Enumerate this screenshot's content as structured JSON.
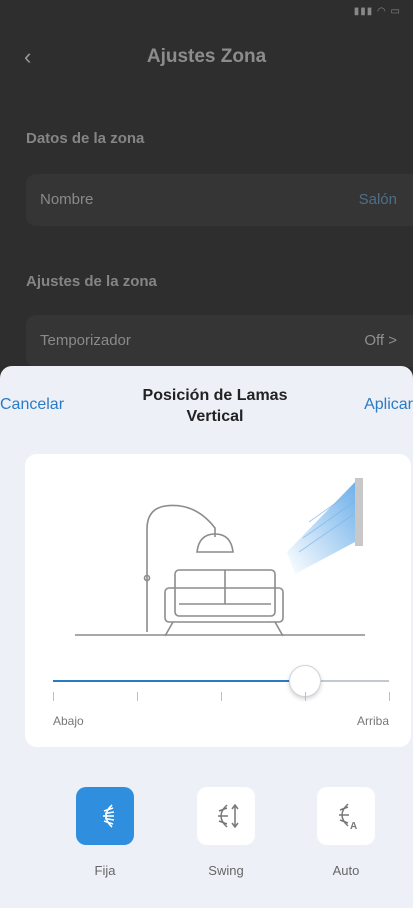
{
  "status_bar": {
    "icons": "signal-wifi-battery"
  },
  "header": {
    "back_icon": "chevron-left-icon",
    "title": "Ajustes Zona"
  },
  "sections": {
    "zone_data": {
      "label": "Datos de la zona",
      "name_row": {
        "label": "Nombre",
        "value": "Salón"
      }
    },
    "zone_settings": {
      "label": "Ajustes de la zona",
      "timer_row": {
        "label": "Temporizador",
        "value": "Off >"
      }
    }
  },
  "sheet": {
    "cancel_label": "Cancelar",
    "title_line1": "Posición de Lamas",
    "title_line2": "Vertical",
    "apply_label": "Aplicar"
  },
  "slider": {
    "min_label": "Abajo",
    "max_label": "Arriba",
    "value_fraction": 0.75,
    "tick_count": 5
  },
  "modes": [
    {
      "label": "Fija",
      "icon": "louver-fixed-icon",
      "active": true
    },
    {
      "label": "Swing",
      "icon": "louver-swing-icon",
      "active": false
    },
    {
      "label": "Auto",
      "icon": "louver-auto-icon",
      "active": false
    }
  ],
  "colors": {
    "accent": "#2b7bc4",
    "active_mode": "#2f8ede",
    "sheet_bg": "#edf1f7"
  }
}
